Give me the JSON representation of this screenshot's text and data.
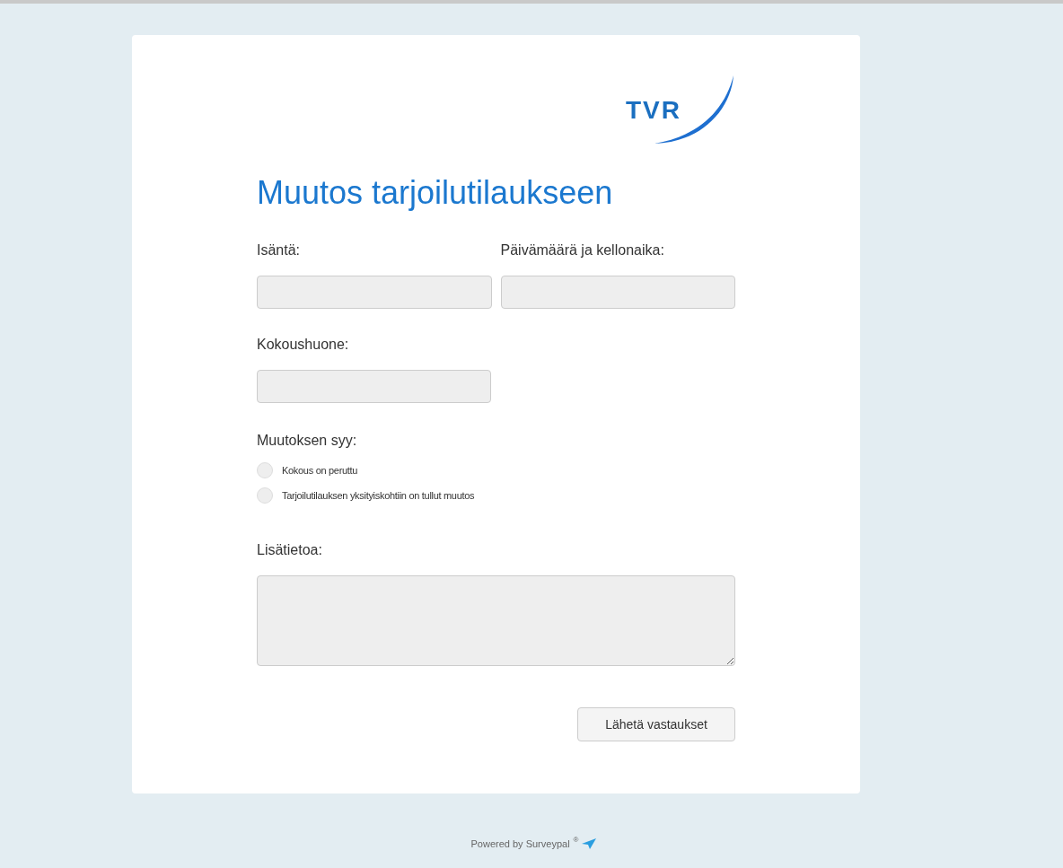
{
  "logo": {
    "text": "TVR"
  },
  "title": "Muutos tarjoilutilaukseen",
  "fields_row": [
    {
      "label": "Isäntä:"
    },
    {
      "label": "Päivämäärä ja kellonaika:"
    }
  ],
  "room": {
    "label": "Kokoushuone:"
  },
  "reason": {
    "label": "Muutoksen syy:",
    "options": [
      {
        "label": "Kokous on peruttu",
        "selected": false
      },
      {
        "label": "Tarjoilutilauksen yksityiskohtiin on tullut muutos",
        "selected": false
      }
    ]
  },
  "notes": {
    "label": "Lisätietoa:"
  },
  "submit": "Lähetä vastaukset",
  "footer": {
    "text": "Powered by Surveypal",
    "mark": "®"
  }
}
